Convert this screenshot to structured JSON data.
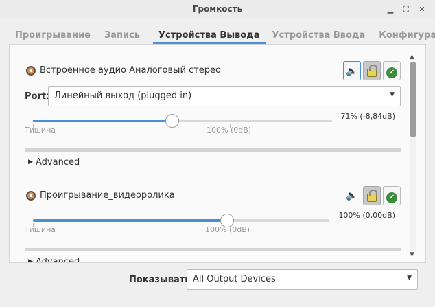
{
  "window": {
    "title": "Громкость"
  },
  "tabs": [
    {
      "label": "Проигрывание"
    },
    {
      "label": "Запись"
    },
    {
      "label": "Устройства Вывода"
    },
    {
      "label": "Устройства Ввода"
    },
    {
      "label": "Конфигурация"
    }
  ],
  "devices": [
    {
      "name": "Встроенное аудио Аналоговый стерео",
      "port_label": "Port:",
      "port_value": "Линейный выход (plugged in)",
      "volume_text": "71% (-8,84dB)",
      "volume_fraction": 0.71,
      "silence_label": "Тишина",
      "norm_label": "100% (0dB)",
      "advanced_label": "Advanced"
    },
    {
      "name": "Проигрывание_видеоролика",
      "volume_text": "100% (0,00dB)",
      "volume_fraction": 1.0,
      "silence_label": "Тишина",
      "norm_label": "100% (0dB)",
      "advanced_label": "Advanced"
    }
  ],
  "footer": {
    "show_label": "Показывать:",
    "show_value": "All Output Devices"
  },
  "colors": {
    "accent": "#4a90d9",
    "lock": "#e7d25a",
    "check": "#3d8b3d",
    "device_icon": "#d98c4a"
  },
  "icons": {
    "minimize": "minimize-icon",
    "maximize": "maximize-icon",
    "close": "close-icon",
    "mute": "speaker-icon",
    "lock": "lock-icon",
    "default": "check-icon",
    "dropdown": "chevron-down-icon",
    "expander": "triangle-right-icon"
  }
}
